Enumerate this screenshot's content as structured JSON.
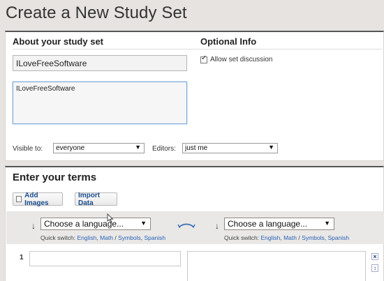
{
  "page": {
    "title": "Create a New Study Set"
  },
  "about": {
    "heading": "About your study set",
    "title_value": "ILoveFreeSoftware",
    "description_value": "ILoveFreeSoftware",
    "visible_label": "Visible to:",
    "visible_value": "everyone",
    "editors_label": "Editors:",
    "editors_value": "just me"
  },
  "optional": {
    "heading": "Optional Info",
    "allow_discussion_label": "Allow set discussion",
    "allow_discussion_checked": true
  },
  "terms": {
    "heading": "Enter your terms",
    "add_images_label": "Add Images",
    "import_label": "Import Data",
    "left_language": "Choose a language...",
    "right_language": "Choose a language...",
    "quick_switch_label": "Quick switch:",
    "quick_english": "English",
    "quick_math": "Math",
    "quick_sep": "/",
    "quick_symbols": "Symbols",
    "quick_spanish": "Spanish",
    "row_number": "1",
    "remove_symbol": "×",
    "move_symbol": "↕",
    "arrow_down": "↓",
    "caret": "▼"
  },
  "colors": {
    "link": "#2a62b8",
    "accent": "#1a4d8f"
  }
}
